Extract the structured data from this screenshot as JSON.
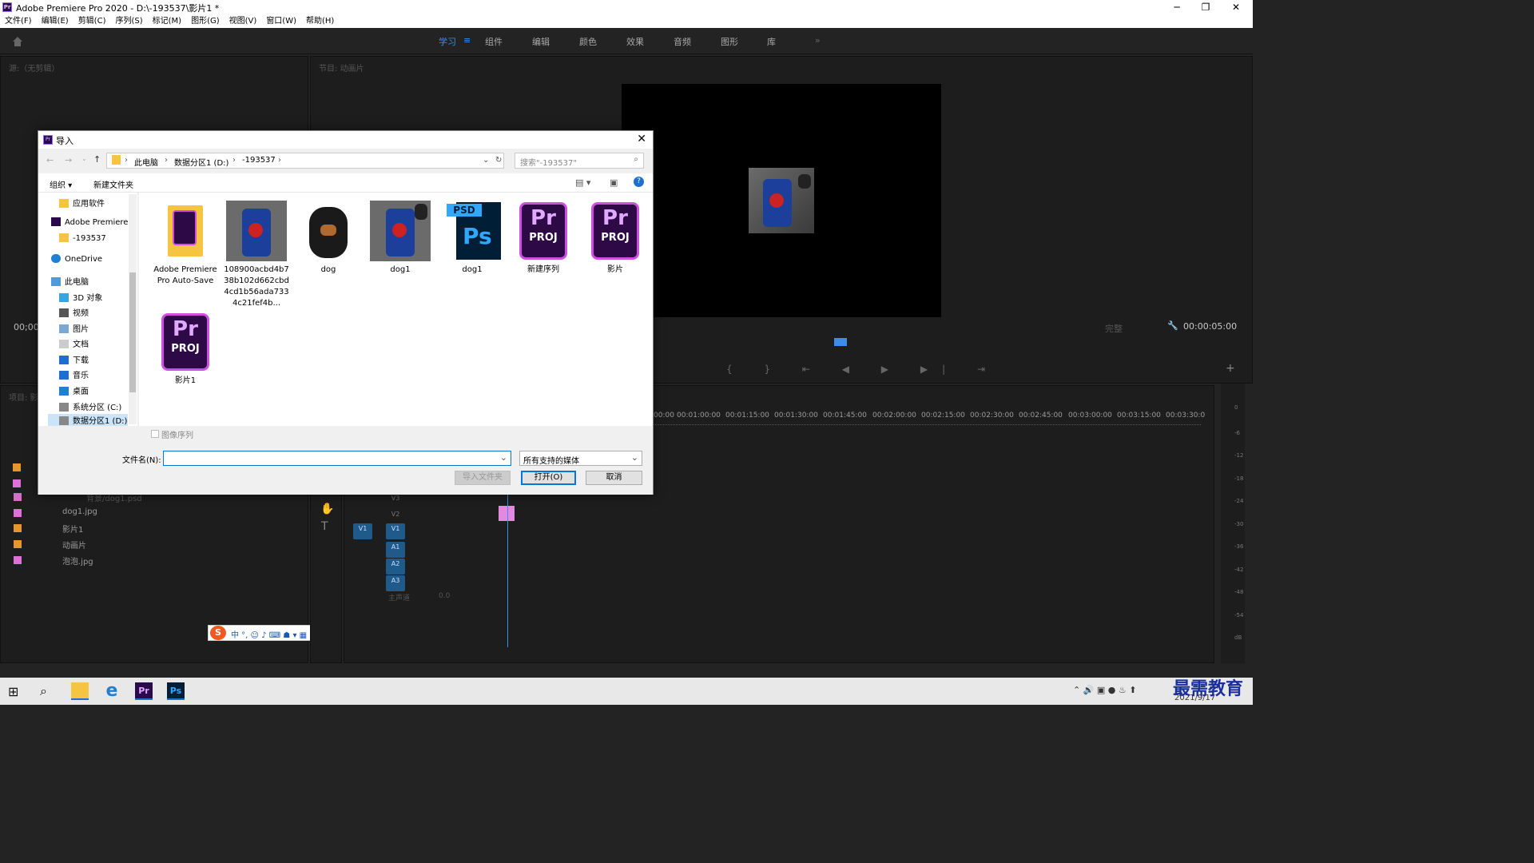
{
  "window": {
    "title": "Adobe Premiere Pro 2020 - D:\\-193537\\影片1 *"
  },
  "menu": [
    "文件(F)",
    "编辑(E)",
    "剪辑(C)",
    "序列(S)",
    "标记(M)",
    "图形(G)",
    "视图(V)",
    "窗口(W)",
    "帮助(H)"
  ],
  "workspaces": [
    "学习",
    "组件",
    "编辑",
    "颜色",
    "效果",
    "音频",
    "图形",
    "库"
  ],
  "source_panel": {
    "title": "源:（无剪辑）"
  },
  "program_panel": {
    "title": "节目: 动画片",
    "timecode": "00:00:05:00",
    "fit": "完整",
    "left_tc": "00;00"
  },
  "project_panel": {
    "title": "项目: 影",
    "items": [
      {
        "name": "背景/dog1.psd",
        "color": "#d070c8"
      },
      {
        "name": "dog1.jpg",
        "color": "#e070d8"
      },
      {
        "name": "影片1",
        "color": "#e8962c"
      },
      {
        "name": "动画片",
        "color": "#e8962c"
      },
      {
        "name": "泡泡.jpg",
        "color": "#e070d8"
      }
    ]
  },
  "timeline": {
    "ruler": [
      "00:00",
      "00:01:00:00",
      "00:01:15:00",
      "00:01:30:00",
      "00:01:45:00",
      "00:02:00:00",
      "00:02:15:00",
      "00:02:30:00",
      "00:02:45:00",
      "00:03:00:00",
      "00:03:15:00",
      "00:03:30:0"
    ],
    "video_tracks": [
      "V3",
      "V2",
      "V1"
    ],
    "audio_tracks": [
      "A1",
      "A2",
      "A3"
    ],
    "master": "主声道",
    "master_val": "0.0",
    "src_patch": "V1"
  },
  "meter_labels": [
    "0",
    "-6",
    "-12",
    "-18",
    "-24",
    "-30",
    "-36",
    "-42",
    "-48",
    "-54",
    "dB"
  ],
  "dialog": {
    "title": "导入",
    "breadcrumb": [
      "此电脑",
      "数据分区1 (D:)",
      "-193537"
    ],
    "search_placeholder": "搜索\"-193537\"",
    "organize": "组织 ▾",
    "new_folder": "新建文件夹",
    "nav_items": [
      "应用软件",
      "Adobe Premiere",
      "-193537",
      "OneDrive",
      "此电脑",
      "3D 对象",
      "视频",
      "图片",
      "文档",
      "下载",
      "音乐",
      "桌面",
      "系统分区 (C:)",
      "数据分区1 (D:)"
    ],
    "files": [
      {
        "name": "Adobe Premiere Pro Auto-Save",
        "type": "folder"
      },
      {
        "name": "108900acbd4b738b102d662cbd4cd1b56ada7334c21fef4b...",
        "type": "photo"
      },
      {
        "name": "dog",
        "type": "dog"
      },
      {
        "name": "dog1",
        "type": "photo"
      },
      {
        "name": "dog1",
        "type": "psd"
      },
      {
        "name": "新建序列",
        "type": "proj"
      },
      {
        "name": "影片",
        "type": "proj"
      },
      {
        "name": "影片1",
        "type": "proj"
      }
    ],
    "image_sequence": "图像序列",
    "filename_label": "文件名(N):",
    "filename_value": "",
    "filter": "所有支持的媒体",
    "import_folder": "导入文件夹",
    "open": "打开(O)",
    "cancel": "取消"
  },
  "taskbar": {
    "date": "2021/9/17",
    "watermark": "最需教育"
  }
}
